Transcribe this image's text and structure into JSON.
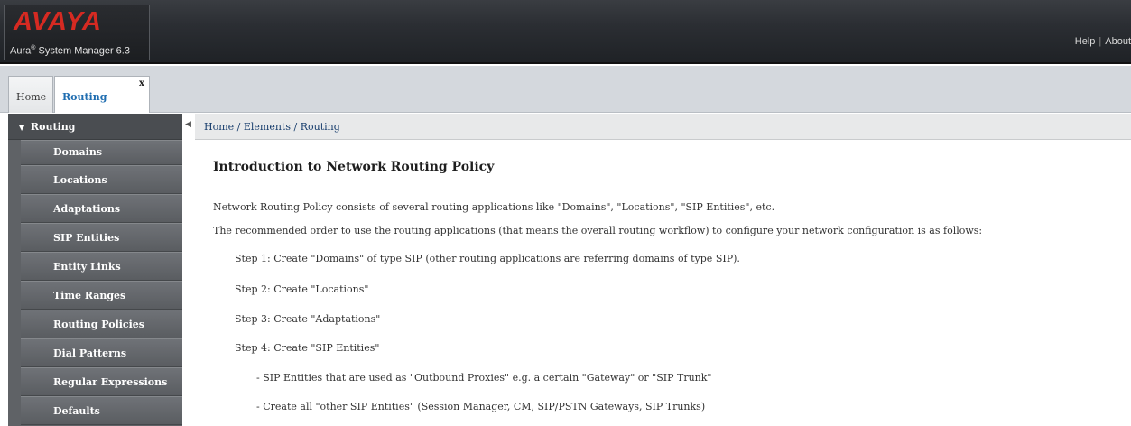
{
  "header": {
    "logo": "AVAYA",
    "product_prefix": "Aura",
    "product_reg": "®",
    "product_name": "System Manager 6.3",
    "links": [
      "Help",
      "About"
    ]
  },
  "tabs": [
    {
      "label": "Home"
    },
    {
      "label": "Routing"
    }
  ],
  "tab_close_glyph": "x",
  "sidebar": {
    "title": "Routing",
    "items": [
      {
        "label": "Domains"
      },
      {
        "label": "Locations"
      },
      {
        "label": "Adaptations"
      },
      {
        "label": "SIP Entities"
      },
      {
        "label": "Entity Links"
      },
      {
        "label": "Time Ranges"
      },
      {
        "label": "Routing Policies"
      },
      {
        "label": "Dial Patterns"
      },
      {
        "label": "Regular Expressions"
      },
      {
        "label": "Defaults"
      }
    ]
  },
  "breadcrumb": "Home / Elements / Routing",
  "main": {
    "title": "Introduction to Network Routing Policy",
    "intro": "Network Routing Policy consists of several routing applications like \"Domains\", \"Locations\", \"SIP Entities\", etc.",
    "order": "The recommended order to use the routing applications (that means the overall routing workflow) to configure your network configuration is as follows:",
    "steps": [
      "Step 1: Create \"Domains\" of type SIP (other routing applications are referring domains of type SIP).",
      "Step 2: Create \"Locations\"",
      "Step 3: Create \"Adaptations\"",
      "Step 4: Create \"SIP Entities\""
    ],
    "substeps": [
      "- SIP Entities that are used as \"Outbound Proxies\" e.g. a certain \"Gateway\" or \"SIP Trunk\"",
      "- Create all \"other SIP Entities\" (Session Manager, CM, SIP/PSTN Gateways, SIP Trunks)"
    ]
  },
  "colors": {
    "logo_red": "#d62a22",
    "header_bg": "#2b2e33",
    "sidebar_bg": "#5f6266",
    "active_tab_text": "#1f6db0"
  }
}
